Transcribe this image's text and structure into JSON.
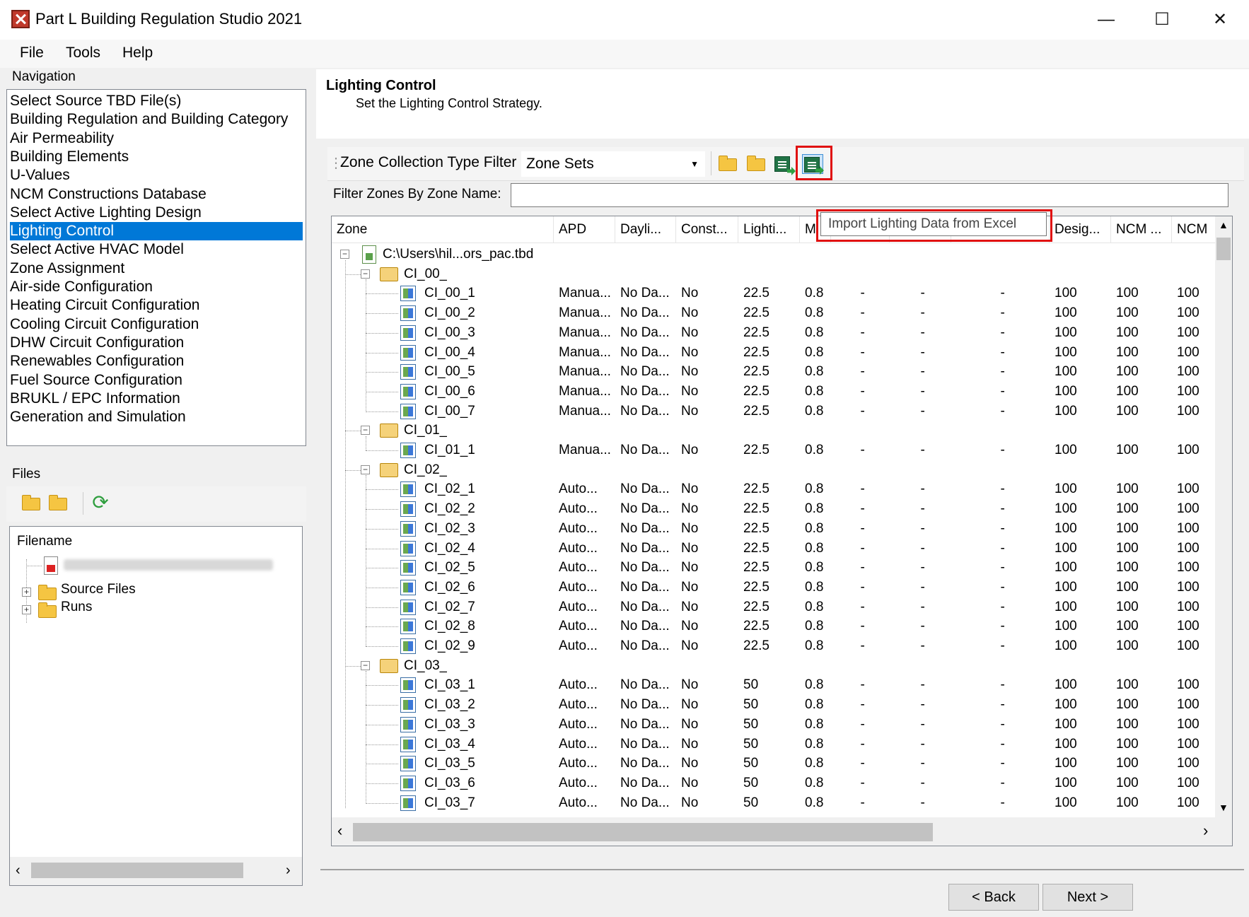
{
  "window": {
    "title": "Part L Building Regulation Studio 2021",
    "min": "—",
    "max": "☐",
    "close": "✕"
  },
  "menu": [
    "File",
    "Tools",
    "Help"
  ],
  "navigation": {
    "label": "Navigation",
    "items": [
      "Select Source TBD File(s)",
      "Building Regulation and Building Category",
      "Air Permeability",
      "Building Elements",
      "U-Values",
      "NCM Constructions Database",
      "Select Active Lighting Design",
      "Lighting Control",
      "Select Active HVAC Model",
      "Zone Assignment",
      "Air-side Configuration",
      "Heating Circuit Configuration",
      "Cooling Circuit Configuration",
      "DHW Circuit Configuration",
      "Renewables Configuration",
      "Fuel Source Configuration",
      "BRUKL / EPC Information",
      "Generation and Simulation"
    ],
    "selected_index": 7
  },
  "files": {
    "label": "Files",
    "column": "Filename",
    "nodes": [
      "Source Files",
      "Runs"
    ]
  },
  "header": {
    "title": "Lighting Control",
    "subtitle": "Set the Lighting Control Strategy."
  },
  "toolbar": {
    "filter_label": "Zone Collection Type Filter",
    "filter_value": "Zone Sets",
    "icons": [
      "open-folder-icon",
      "folder-icon",
      "export-excel-icon",
      "import-excel-icon"
    ]
  },
  "filter_zones_label": "Filter Zones By Zone Name:",
  "filter_zones_value": "",
  "tooltip": "Import Lighting Data from Excel",
  "grid": {
    "columns": [
      "Zone",
      "APD",
      "Dayli...",
      "Const...",
      "Lighti...",
      "M",
      "",
      "",
      "",
      "Desig...",
      "NCM ...",
      "NCM"
    ],
    "root": "C:\\Users\\hil...ors_pac.tbd",
    "groups": [
      {
        "name": "CI_00_",
        "rows": [
          [
            "CI_00_1",
            "Manua...",
            "No Da...",
            "No",
            "22.5",
            "0.8",
            "-",
            "-",
            "-",
            "100",
            "100",
            "100"
          ],
          [
            "CI_00_2",
            "Manua...",
            "No Da...",
            "No",
            "22.5",
            "0.8",
            "-",
            "-",
            "-",
            "100",
            "100",
            "100"
          ],
          [
            "CI_00_3",
            "Manua...",
            "No Da...",
            "No",
            "22.5",
            "0.8",
            "-",
            "-",
            "-",
            "100",
            "100",
            "100"
          ],
          [
            "CI_00_4",
            "Manua...",
            "No Da...",
            "No",
            "22.5",
            "0.8",
            "-",
            "-",
            "-",
            "100",
            "100",
            "100"
          ],
          [
            "CI_00_5",
            "Manua...",
            "No Da...",
            "No",
            "22.5",
            "0.8",
            "-",
            "-",
            "-",
            "100",
            "100",
            "100"
          ],
          [
            "CI_00_6",
            "Manua...",
            "No Da...",
            "No",
            "22.5",
            "0.8",
            "-",
            "-",
            "-",
            "100",
            "100",
            "100"
          ],
          [
            "CI_00_7",
            "Manua...",
            "No Da...",
            "No",
            "22.5",
            "0.8",
            "-",
            "-",
            "-",
            "100",
            "100",
            "100"
          ]
        ]
      },
      {
        "name": "CI_01_",
        "rows": [
          [
            "CI_01_1",
            "Manua...",
            "No Da...",
            "No",
            "22.5",
            "0.8",
            "-",
            "-",
            "-",
            "100",
            "100",
            "100"
          ]
        ]
      },
      {
        "name": "CI_02_",
        "rows": [
          [
            "CI_02_1",
            "Auto...",
            "No Da...",
            "No",
            "22.5",
            "0.8",
            "-",
            "-",
            "-",
            "100",
            "100",
            "100"
          ],
          [
            "CI_02_2",
            "Auto...",
            "No Da...",
            "No",
            "22.5",
            "0.8",
            "-",
            "-",
            "-",
            "100",
            "100",
            "100"
          ],
          [
            "CI_02_3",
            "Auto...",
            "No Da...",
            "No",
            "22.5",
            "0.8",
            "-",
            "-",
            "-",
            "100",
            "100",
            "100"
          ],
          [
            "CI_02_4",
            "Auto...",
            "No Da...",
            "No",
            "22.5",
            "0.8",
            "-",
            "-",
            "-",
            "100",
            "100",
            "100"
          ],
          [
            "CI_02_5",
            "Auto...",
            "No Da...",
            "No",
            "22.5",
            "0.8",
            "-",
            "-",
            "-",
            "100",
            "100",
            "100"
          ],
          [
            "CI_02_6",
            "Auto...",
            "No Da...",
            "No",
            "22.5",
            "0.8",
            "-",
            "-",
            "-",
            "100",
            "100",
            "100"
          ],
          [
            "CI_02_7",
            "Auto...",
            "No Da...",
            "No",
            "22.5",
            "0.8",
            "-",
            "-",
            "-",
            "100",
            "100",
            "100"
          ],
          [
            "CI_02_8",
            "Auto...",
            "No Da...",
            "No",
            "22.5",
            "0.8",
            "-",
            "-",
            "-",
            "100",
            "100",
            "100"
          ],
          [
            "CI_02_9",
            "Auto...",
            "No Da...",
            "No",
            "22.5",
            "0.8",
            "-",
            "-",
            "-",
            "100",
            "100",
            "100"
          ]
        ]
      },
      {
        "name": "CI_03_",
        "rows": [
          [
            "CI_03_1",
            "Auto...",
            "No Da...",
            "No",
            "50",
            "0.8",
            "-",
            "-",
            "-",
            "100",
            "100",
            "100"
          ],
          [
            "CI_03_2",
            "Auto...",
            "No Da...",
            "No",
            "50",
            "0.8",
            "-",
            "-",
            "-",
            "100",
            "100",
            "100"
          ],
          [
            "CI_03_3",
            "Auto...",
            "No Da...",
            "No",
            "50",
            "0.8",
            "-",
            "-",
            "-",
            "100",
            "100",
            "100"
          ],
          [
            "CI_03_4",
            "Auto...",
            "No Da...",
            "No",
            "50",
            "0.8",
            "-",
            "-",
            "-",
            "100",
            "100",
            "100"
          ],
          [
            "CI_03_5",
            "Auto...",
            "No Da...",
            "No",
            "50",
            "0.8",
            "-",
            "-",
            "-",
            "100",
            "100",
            "100"
          ],
          [
            "CI_03_6",
            "Auto...",
            "No Da...",
            "No",
            "50",
            "0.8",
            "-",
            "-",
            "-",
            "100",
            "100",
            "100"
          ],
          [
            "CI_03_7",
            "Auto...",
            "No Da...",
            "No",
            "50",
            "0.8",
            "-",
            "-",
            "-",
            "100",
            "100",
            "100"
          ]
        ]
      }
    ]
  },
  "buttons": {
    "back": "< Back",
    "next": "Next >"
  }
}
